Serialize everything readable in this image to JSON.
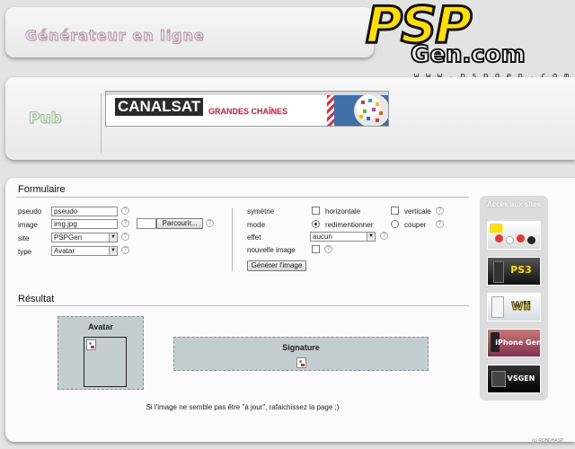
{
  "header": {
    "title": "Générateur en ligne",
    "logo_psp": "PSP",
    "logo_gen": "Gen.com",
    "logo_url": "w w w . p s p g e n . c o m"
  },
  "pub": {
    "label": "Pub",
    "banner_brand": "CANALSAT",
    "banner_text": "GRANDES CHAÎNES"
  },
  "form": {
    "title": "Formulaire",
    "pseudo_label": "pseudo",
    "pseudo_value": "pseudo",
    "image_label": "image",
    "image_value": "img.jpg",
    "browse_label": "Parcourir...",
    "site_label": "site",
    "site_value": "PSPGen",
    "type_label": "type",
    "type_value": "Avatar",
    "symetrie_label": "symétrie",
    "horizontale_label": "horizontale",
    "verticale_label": "verticale",
    "mode_label": "mode",
    "redimentionner_label": "redimentionner",
    "couper_label": "couper",
    "effet_label": "effet",
    "effet_value": "aucun",
    "nouvelle_image_label": "nouvelle image",
    "generate_label": "Générer l'image",
    "help_glyph": "?"
  },
  "result": {
    "title": "Résultat",
    "avatar_title": "Avatar",
    "signature_title": "Signature",
    "note": "Si l'image ne semble pas être \"à jour\", rafaichissez la page ;)"
  },
  "sidebar": {
    "title": "Accès aux sites",
    "tiles": [
      {
        "label": "",
        "color": "#f4f4f4"
      },
      {
        "label": "PS3",
        "color": "#2a2a2a"
      },
      {
        "label": "Wii",
        "color": "#e8eef2"
      },
      {
        "label": "iPhone Gen",
        "color": "#b05a7a"
      },
      {
        "label": "VSGEN",
        "color": "#111111"
      }
    ]
  },
  "footer": {
    "credit": "(c) ROBDHASP"
  },
  "colors": {
    "accent_yellow": "#ffde00",
    "result_bg": "#c4cdd0",
    "banner_red": "#d1192e"
  }
}
